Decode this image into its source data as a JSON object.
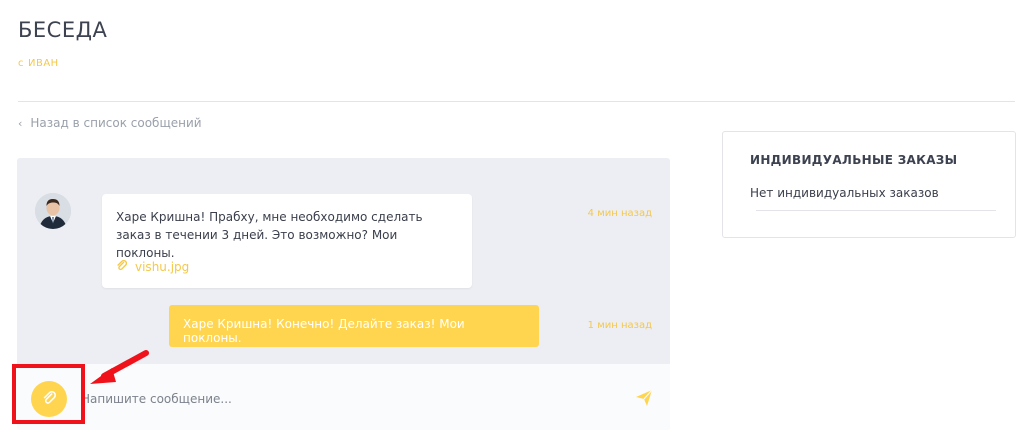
{
  "header": {
    "title": "БЕСЕДА",
    "subtitle_prefix": "с",
    "subtitle_user": "ИВАН"
  },
  "back_link": {
    "label": "Назад в список сообщений"
  },
  "chat": {
    "messages": [
      {
        "direction": "incoming",
        "text": "Харе Кришна! Прабху, мне необходимо сделать заказ в течении 3 дней. Это возможно? Мои поклоны.",
        "attachment": "vishu.jpg",
        "time": "4 мин назад"
      },
      {
        "direction": "outgoing",
        "text": "Харе Кришна! Конечно! Делайте заказ! Мои поклоны.",
        "time": "1 мин назад"
      }
    ],
    "input": {
      "placeholder": "Напишите сообщение...",
      "value": ""
    }
  },
  "sidebar": {
    "title": "ИНДИВИДУАЛЬНЫЕ ЗАКАЗЫ",
    "empty_text": "Нет индивидуальных заказов"
  },
  "colors": {
    "accent": "#ffd54f",
    "accent_text": "#f5c84a",
    "panel_bg": "#eceef3",
    "annotation": "#f0121b"
  },
  "icons": {
    "back": "chevron-left-icon",
    "attachment": "paperclip-icon",
    "attach_button": "paperclip-icon",
    "send": "send-icon"
  }
}
